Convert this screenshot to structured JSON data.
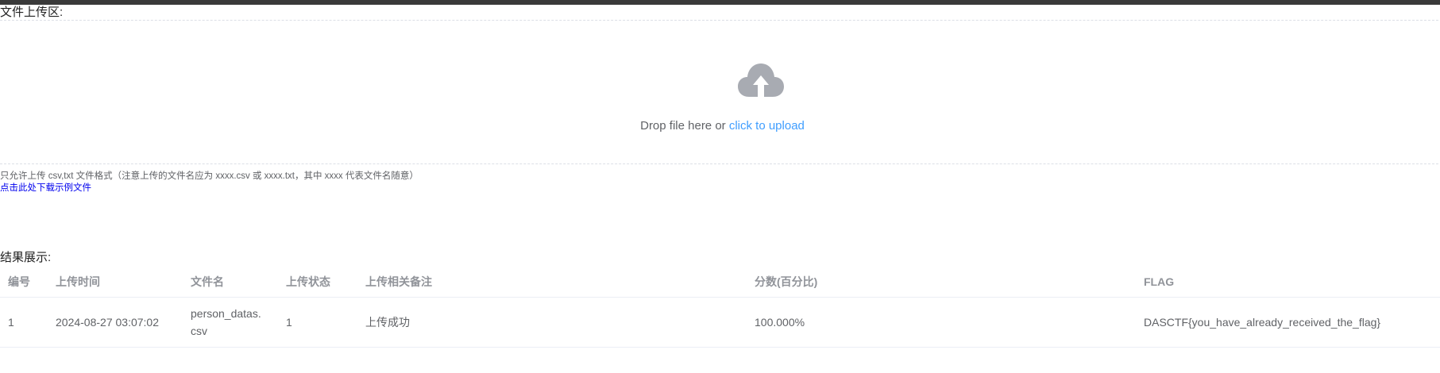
{
  "upload": {
    "title": "文件上传区:",
    "drop_text": "Drop file here or ",
    "click_text": "click to upload",
    "tip": "只允许上传 csv,txt 文件格式（注意上传的文件名应为 xxxx.csv 或 xxxx.txt，其中 xxxx 代表文件名随意）",
    "download_link": "点击此处下载示例文件",
    "icon": "upload-cloud-icon"
  },
  "results": {
    "title": "结果展示:",
    "columns": [
      "编号",
      "上传时间",
      "文件名",
      "上传状态",
      "上传相关备注",
      "分数(百分比)",
      "FLAG"
    ],
    "rows": [
      {
        "id": "1",
        "time": "2024-08-27 03:07:02",
        "file_line1": "person_datas.",
        "file_line2": "csv",
        "status": "1",
        "remark": "上传成功",
        "score": "100.000%",
        "flag": "DASCTF{you_have_already_received_the_flag}"
      }
    ]
  },
  "colors": {
    "accent": "#409eff",
    "text": "#606266",
    "header": "#909399",
    "icon": "#a8abb2"
  }
}
